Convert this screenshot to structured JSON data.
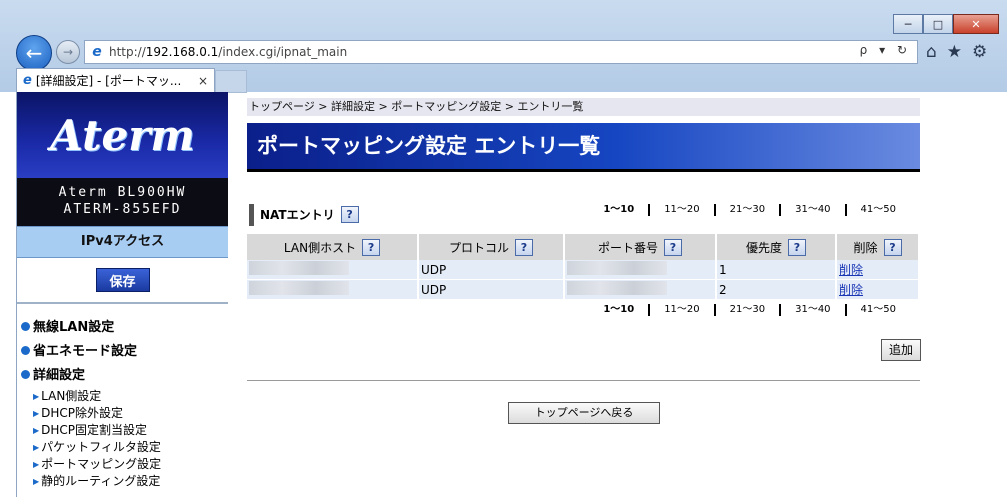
{
  "browser": {
    "url_prefix": "http://",
    "url_host": "192.168.0.1",
    "url_path": "/index.cgi/ipnat_main",
    "addr_tools": "ρ ▾ ↻",
    "tab_title": "[詳細設定] - [ポートマッ...",
    "tab_close": "×",
    "win_min": "─",
    "win_max": "□",
    "win_close": "✕"
  },
  "sidebar": {
    "logo": "Aterm",
    "model_line1": "Aterm BL900HW",
    "model_line2": "ATERM-855EFD",
    "mode": "IPv4アクセス",
    "save_label": "保存",
    "menu_heads": [
      "無線LAN設定",
      "省エネモード設定",
      "詳細設定"
    ],
    "menu_items": [
      "LAN側設定",
      "DHCP除外設定",
      "DHCP固定割当設定",
      "パケットフィルタ設定",
      "ポートマッピング設定",
      "静的ルーティング設定"
    ]
  },
  "main": {
    "breadcrumb": "トップページ > 詳細設定 > ポートマッピング設定 > エントリ一覧",
    "title": "ポートマッピング設定 エントリ一覧",
    "section": "NATエントリ",
    "help": "?",
    "pager": [
      "1〜10",
      "11〜20",
      "21〜30",
      "31〜40",
      "41〜50"
    ],
    "columns": [
      "LAN側ホスト",
      "プロトコル",
      "ポート番号",
      "優先度",
      "削除"
    ],
    "rows": [
      {
        "protocol": "UDP",
        "priority": "1",
        "delete": "削除"
      },
      {
        "protocol": "UDP",
        "priority": "2",
        "delete": "削除"
      }
    ],
    "add_label": "追加",
    "back_label": "トップページへ戻る"
  }
}
